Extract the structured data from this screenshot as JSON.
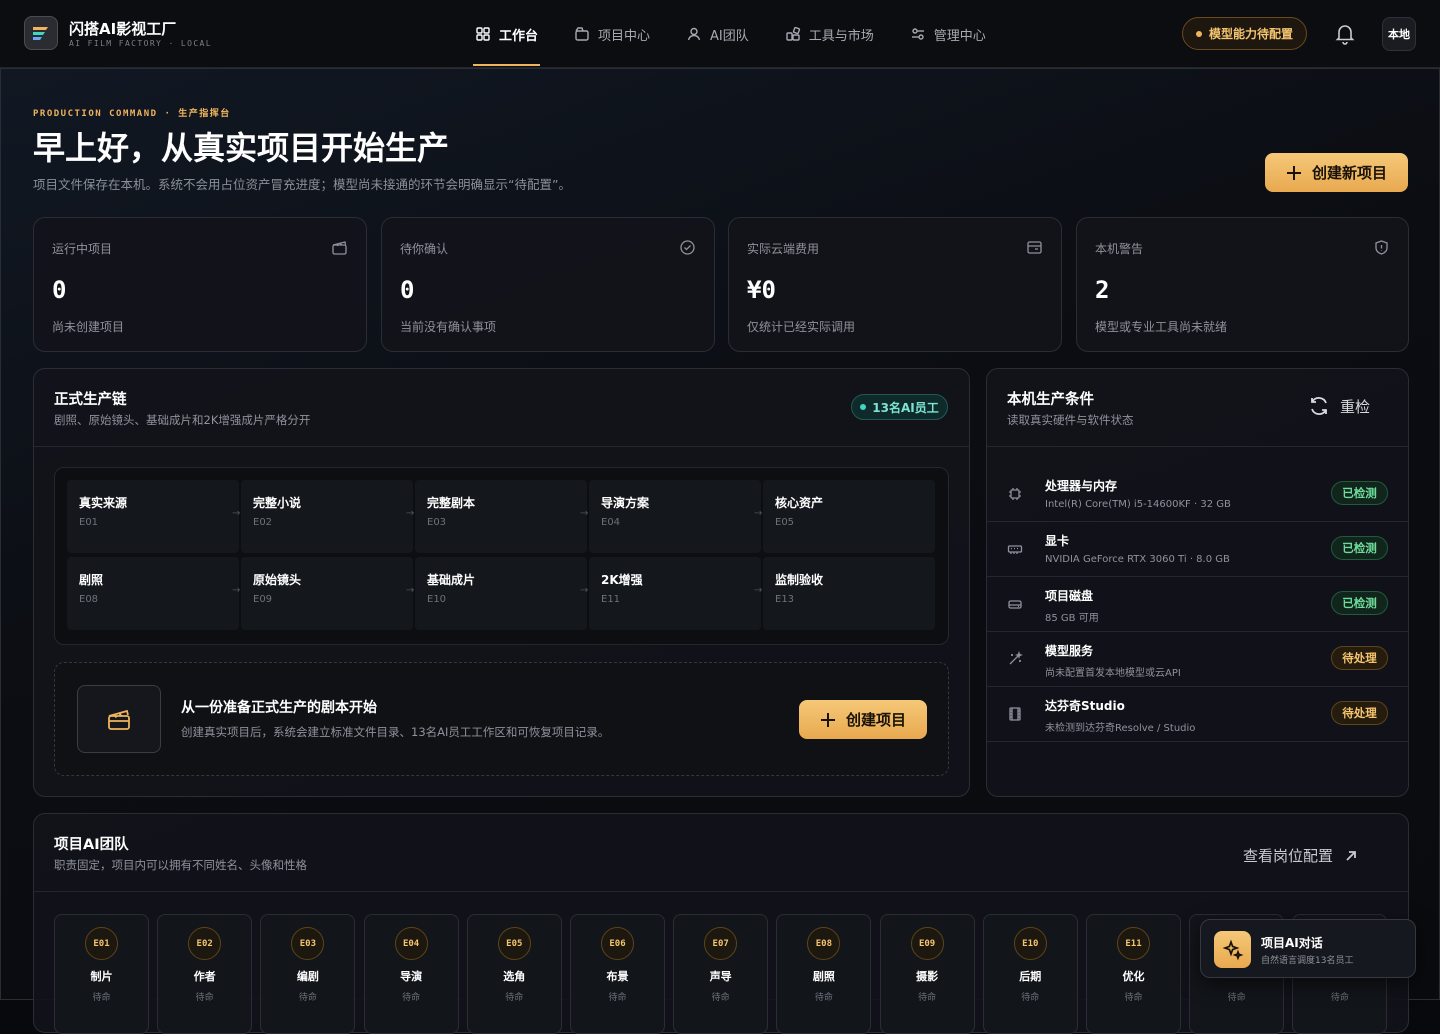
{
  "brand": {
    "title": "闪搭AI影视工厂",
    "subtitle": "AI FILM FACTORY · LOCAL"
  },
  "nav": [
    {
      "label": "工作台",
      "icon": "dashboard-icon",
      "active": true
    },
    {
      "label": "项目中心",
      "icon": "folder-icon",
      "active": false
    },
    {
      "label": "AI团队",
      "icon": "user-icon",
      "active": false
    },
    {
      "label": "工具与市场",
      "icon": "apps-icon",
      "active": false
    },
    {
      "label": "管理中心",
      "icon": "sliders-icon",
      "active": false
    }
  ],
  "header": {
    "model_status": "模型能力待配置",
    "local_label": "本地"
  },
  "hero": {
    "kicker": "PRODUCTION COMMAND · 生产指挥台",
    "title": "早上好，从真实项目开始生产",
    "subtitle": "项目文件保存在本机。系统不会用占位资产冒充进度；模型尚未接通的环节会明确显示“待配置”。",
    "new_button": "创建新项目"
  },
  "stats": [
    {
      "label": "运行中项目",
      "value": "0",
      "note": "尚未创建项目",
      "icon": "clapper-icon"
    },
    {
      "label": "待你确认",
      "value": "0",
      "note": "当前没有确认事项",
      "icon": "check-circle-icon"
    },
    {
      "label": "实际云端费用",
      "value": "¥0",
      "note": "仅统计已经实际调用",
      "icon": "wallet-icon"
    },
    {
      "label": "本机警告",
      "value": "2",
      "note": "模型或专业工具尚未就绪",
      "icon": "shield-icon"
    }
  ],
  "chain": {
    "title": "正式生产链",
    "subtitle": "剧照、原始镜头、基础成片和2K增强成片严格分开",
    "badge": "13名AI员工",
    "arrow": "→",
    "rows": [
      [
        {
          "name": "真实来源",
          "code": "E01"
        },
        {
          "name": "完整小说",
          "code": "E02"
        },
        {
          "name": "完整剧本",
          "code": "E03"
        },
        {
          "name": "导演方案",
          "code": "E04"
        },
        {
          "name": "核心资产",
          "code": "E05"
        }
      ],
      [
        {
          "name": "剧照",
          "code": "E08"
        },
        {
          "name": "原始镜头",
          "code": "E09"
        },
        {
          "name": "基础成片",
          "code": "E10"
        },
        {
          "name": "2K增强",
          "code": "E11"
        },
        {
          "name": "监制验收",
          "code": "E13"
        }
      ]
    ],
    "empty_title": "从一份准备正式生产的剧本开始",
    "empty_desc": "创建真实项目后，系统会建立标准文件目录、13名AI员工工作区和可恢复项目记录。",
    "create_button": "创建项目"
  },
  "conditions": {
    "title": "本机生产条件",
    "subtitle": "读取真实硬件与软件状态",
    "recheck": "重检",
    "items": [
      {
        "name": "处理器与内存",
        "detail": "Intel(R) Core(TM) i5-14600KF · 32 GB",
        "status": "已检测",
        "ok": true,
        "icon": "cpu-icon"
      },
      {
        "name": "显卡",
        "detail": "NVIDIA GeForce RTX 3060 Ti · 8.0 GB",
        "status": "已检测",
        "ok": true,
        "icon": "gpu-icon"
      },
      {
        "name": "项目磁盘",
        "detail": "85 GB 可用",
        "status": "已检测",
        "ok": true,
        "icon": "disk-icon"
      },
      {
        "name": "模型服务",
        "detail": "尚未配置首发本地模型或云API",
        "status": "待处理",
        "ok": false,
        "icon": "magic-wand-icon"
      },
      {
        "name": "达芬奇Studio",
        "detail": "未检测到达芬奇Resolve / Studio",
        "status": "待处理",
        "ok": false,
        "icon": "film-icon"
      }
    ]
  },
  "team": {
    "title": "项目AI团队",
    "subtitle": "职责固定，项目内可以拥有不同姓名、头像和性格",
    "view_roles": "查看岗位配置",
    "members": [
      {
        "code": "E01",
        "role": "制片",
        "status": "待命"
      },
      {
        "code": "E02",
        "role": "作者",
        "status": "待命"
      },
      {
        "code": "E03",
        "role": "编剧",
        "status": "待命"
      },
      {
        "code": "E04",
        "role": "导演",
        "status": "待命"
      },
      {
        "code": "E05",
        "role": "选角",
        "status": "待命"
      },
      {
        "code": "E06",
        "role": "布景",
        "status": "待命"
      },
      {
        "code": "E07",
        "role": "声导",
        "status": "待命"
      },
      {
        "code": "E08",
        "role": "剧照",
        "status": "待命"
      },
      {
        "code": "E09",
        "role": "摄影",
        "status": "待命"
      },
      {
        "code": "E10",
        "role": "后期",
        "status": "待命"
      },
      {
        "code": "E11",
        "role": "优化",
        "status": "待命"
      },
      {
        "code": "",
        "role": "",
        "status": "待命"
      },
      {
        "code": "",
        "role": "",
        "status": "待命"
      }
    ]
  },
  "chat": {
    "title": "项目AI对话",
    "subtitle": "自然语言调度13名员工"
  }
}
